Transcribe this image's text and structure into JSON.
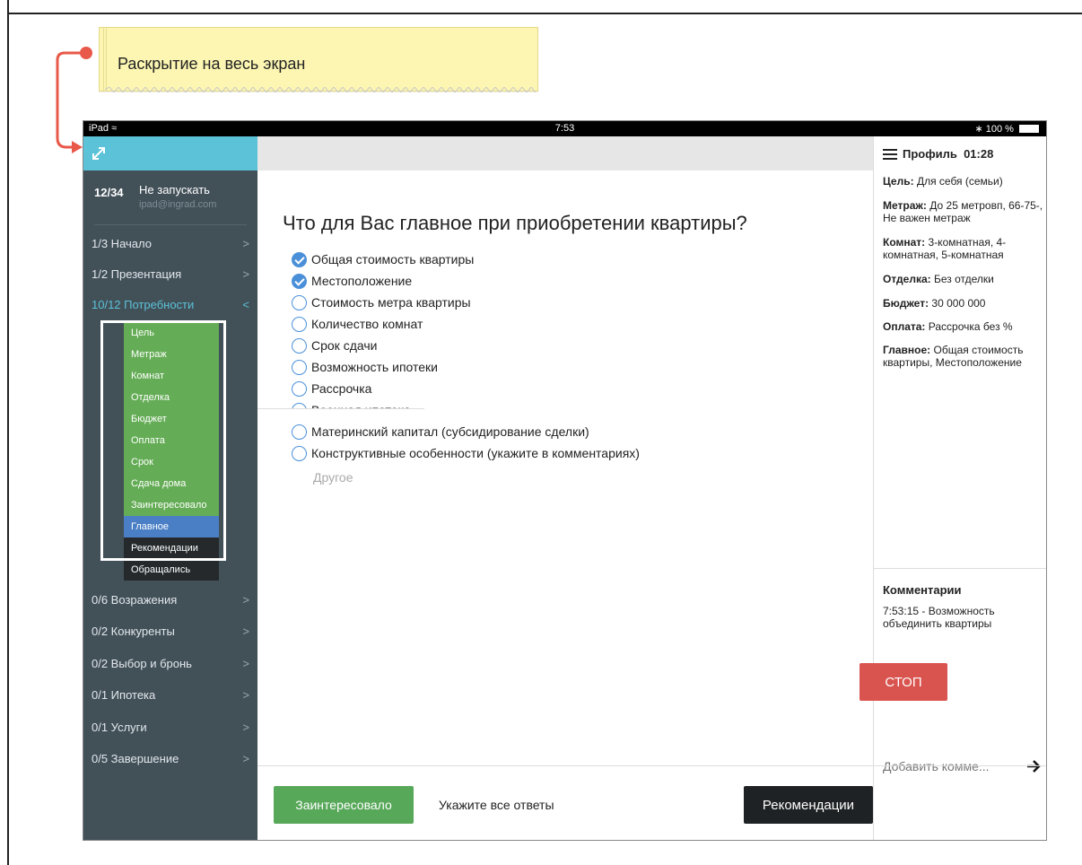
{
  "note": {
    "text": "Раскрытие на весь экран"
  },
  "statusbar": {
    "device": "iPad",
    "time": "7:53",
    "battery": "100 %"
  },
  "session": {
    "counter": "12/34",
    "title": "Не запускать",
    "email": "ipad@ingrad.com"
  },
  "sidebar": {
    "items_top": [
      {
        "label": "1/3 Начало"
      },
      {
        "label": "1/2 Презентация"
      },
      {
        "label": "10/12 Потребности"
      }
    ],
    "subitems": [
      {
        "label": "Цель"
      },
      {
        "label": "Метраж"
      },
      {
        "label": "Комнат"
      },
      {
        "label": "Отделка"
      },
      {
        "label": "Бюджет"
      },
      {
        "label": "Оплата"
      },
      {
        "label": "Срок"
      },
      {
        "label": "Сдача дома"
      },
      {
        "label": "Заинтересовало"
      },
      {
        "label": "Главное"
      },
      {
        "label": "Рекомендации"
      },
      {
        "label": "Обращались"
      }
    ],
    "items_bottom": [
      {
        "label": "0/6 Возражения"
      },
      {
        "label": "0/2 Конкуренты"
      },
      {
        "label": "0/2 Выбор и бронь"
      },
      {
        "label": "0/1 Ипотека"
      },
      {
        "label": "0/1 Услуги"
      },
      {
        "label": "0/5 Завершение"
      }
    ],
    "chevron_right": ">",
    "chevron_left": "<"
  },
  "main": {
    "question": "Что для Вас главное при приобретении квартиры?",
    "options": [
      {
        "label": "Общая стоимость квартиры",
        "checked": true
      },
      {
        "label": "Местоположение",
        "checked": true
      },
      {
        "label": "Стоимость метра квартиры",
        "checked": false
      },
      {
        "label": "Количество комнат",
        "checked": false
      },
      {
        "label": "Срок сдачи",
        "checked": false
      },
      {
        "label": "Возможность ипотеки",
        "checked": false
      },
      {
        "label": "Рассрочка",
        "checked": false
      },
      {
        "label": "Военная ипотека",
        "checked": false
      },
      {
        "label": "Материнский капитал (субсидирование сделки)",
        "checked": false
      },
      {
        "label": "Конструктивные особенности (укажите в комментариях)",
        "checked": false
      }
    ],
    "other": "Другое"
  },
  "profile": {
    "title": "Профиль",
    "timer": "01:28",
    "fields": [
      {
        "key": "Цель:",
        "value": "Для себя (семьи)"
      },
      {
        "key": "Метраж:",
        "value": "До 25 метровп, 66-75-, Не важен метраж"
      },
      {
        "key": "Комнат:",
        "value": "3-комнатная, 4-комнатная, 5-комнатная"
      },
      {
        "key": "Отделка:",
        "value": "Без отделки"
      },
      {
        "key": "Бюджет:",
        "value": "30 000 000"
      },
      {
        "key": "Оплата:",
        "value": "Рассрочка без %"
      },
      {
        "key": "Главное:",
        "value": "Общая стоимость квартиры, Местоположение"
      }
    ]
  },
  "comments": {
    "title": "Комментарии",
    "items": [
      "7:53:15 - Возможность объединить квартиры"
    ],
    "placeholder": "Добавить комме..."
  },
  "footer": {
    "interested_label": "Заинтересовало",
    "hint": "Укажите все ответы",
    "recommendations_label": "Рекомендации",
    "stop_label": "СТОП"
  },
  "colors": {
    "accent": "#5bc2d8",
    "sidebar_bg": "#425058",
    "green": "#64ac55",
    "blue": "#4a7fc6",
    "stop_red": "#d9534f",
    "annotation_red": "#e8594a"
  },
  "icons": [
    "expand-icon",
    "wifi-icon",
    "bluetooth-icon",
    "battery-icon",
    "menu-icon",
    "arrow-right-icon",
    "checkmark-icon"
  ]
}
